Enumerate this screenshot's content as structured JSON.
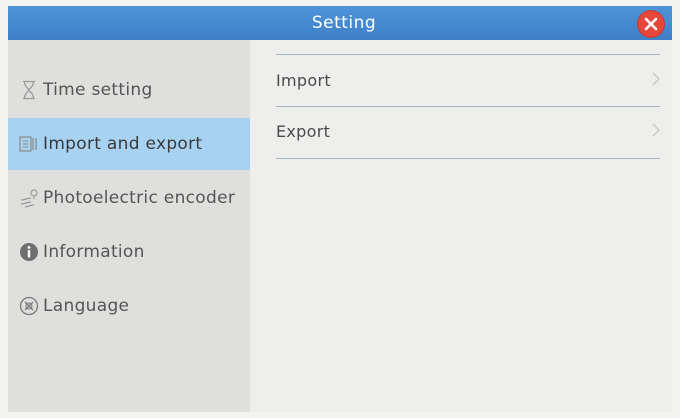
{
  "window": {
    "title": "Setting"
  },
  "sidebar": {
    "items": [
      {
        "label": "Time setting",
        "icon": "hourglass-icon"
      },
      {
        "label": "Import and export",
        "icon": "import-export-icon"
      },
      {
        "label": "Photoelectric encoder",
        "icon": "encoder-icon"
      },
      {
        "label": "Information",
        "icon": "info-icon"
      },
      {
        "label": "Language",
        "icon": "language-icon"
      }
    ],
    "selected": "Import and export"
  },
  "main": {
    "rows": [
      {
        "label": "Import",
        "icon": "chevron-right-icon"
      },
      {
        "label": "Export",
        "icon": "chevron-right-icon"
      }
    ]
  },
  "colors": {
    "titlebar": "#4188cf",
    "selected_item": "#a7d2f1",
    "close_button": "#e5483b",
    "divider": "#a8b8c8"
  }
}
